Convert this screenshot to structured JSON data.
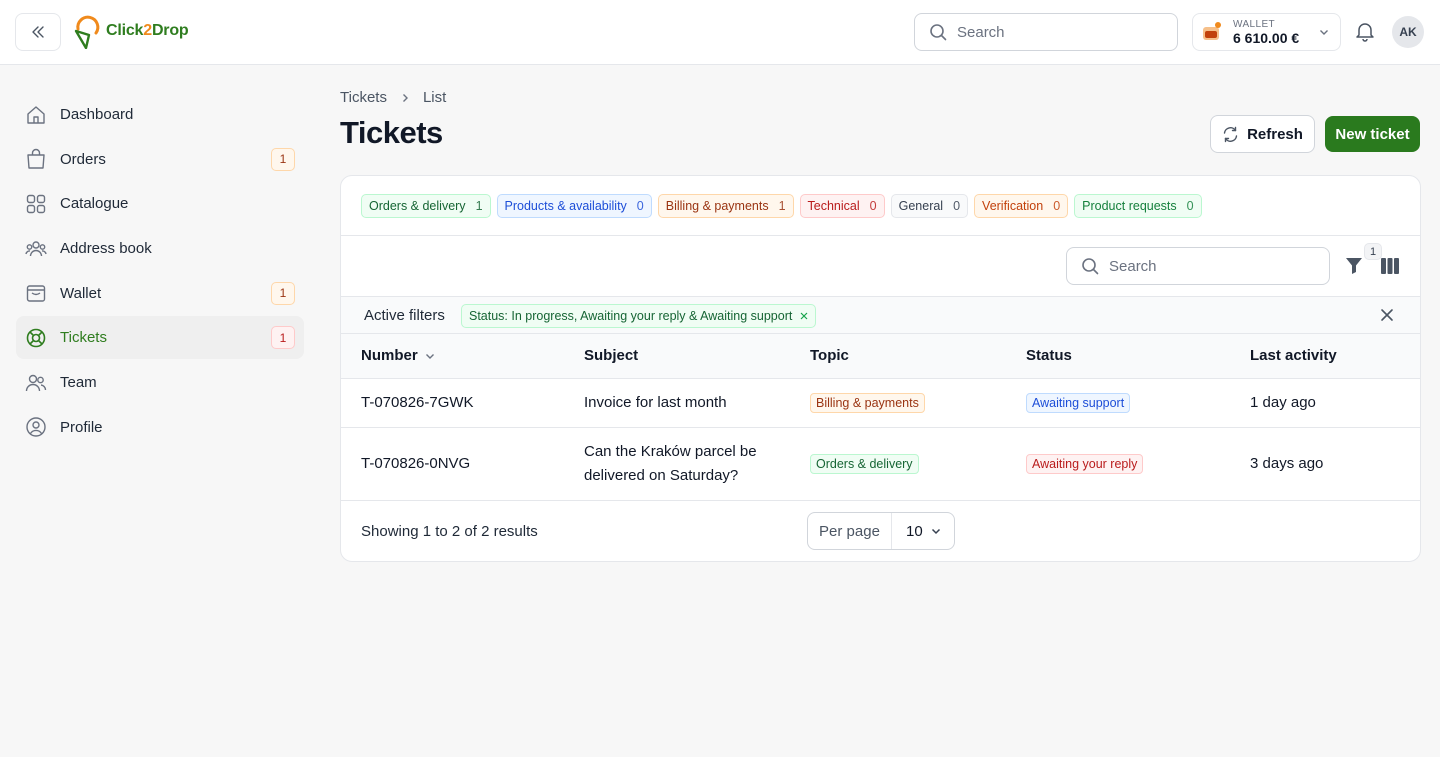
{
  "brand": {
    "name_a": "Click",
    "name_b": "2",
    "name_c": "Drop",
    "accent": "#2a7a1e",
    "accent_orange": "#f08a1c"
  },
  "header": {
    "search_placeholder": "Search",
    "wallet": {
      "label": "WALLET",
      "amount": "6 610.00 €"
    },
    "avatar_initials": "AK"
  },
  "sidebar": {
    "items": [
      {
        "label": "Dashboard",
        "icon": "home-icon"
      },
      {
        "label": "Orders",
        "icon": "shopping-bag-icon",
        "badge": "1"
      },
      {
        "label": "Catalogue",
        "icon": "grid-icon"
      },
      {
        "label": "Address book",
        "icon": "users-group-icon"
      },
      {
        "label": "Wallet",
        "icon": "wallet-icon",
        "badge": "1"
      },
      {
        "label": "Tickets",
        "icon": "lifebuoy-icon",
        "badge": "1",
        "active": true
      },
      {
        "label": "Team",
        "icon": "team-icon"
      },
      {
        "label": "Profile",
        "icon": "user-circle-icon"
      }
    ]
  },
  "page": {
    "breadcrumb": [
      "Tickets",
      "List"
    ],
    "title": "Tickets",
    "refresh_label": "Refresh",
    "new_label": "New ticket"
  },
  "topics": [
    {
      "label": "Orders & delivery",
      "count": "1"
    },
    {
      "label": "Products & availability",
      "count": "0"
    },
    {
      "label": "Billing & payments",
      "count": "1"
    },
    {
      "label": "Technical",
      "count": "0"
    },
    {
      "label": "General",
      "count": "0"
    },
    {
      "label": "Verification",
      "count": "0"
    },
    {
      "label": "Product requests",
      "count": "0"
    }
  ],
  "table": {
    "search_placeholder": "Search",
    "filter_count": "1",
    "active_filters_label": "Active filters",
    "active_filter": "Status: In progress, Awaiting your reply & Awaiting support",
    "columns": [
      "Number",
      "Subject",
      "Topic",
      "Status",
      "Last activity"
    ],
    "rows": [
      {
        "number": "T-070826-7GWK",
        "subject": "Invoice for last month",
        "topic": "Billing & payments",
        "status": "Awaiting support",
        "last_activity": "1 day ago"
      },
      {
        "number": "T-070826-0NVG",
        "subject": "Can the Kraków parcel be delivered on Saturday?",
        "topic": "Orders & delivery",
        "status": "Awaiting your reply",
        "last_activity": "3 days ago"
      }
    ],
    "showing": "Showing 1 to 2 of 2 results",
    "per_page_label": "Per page",
    "per_page_value": "10"
  }
}
